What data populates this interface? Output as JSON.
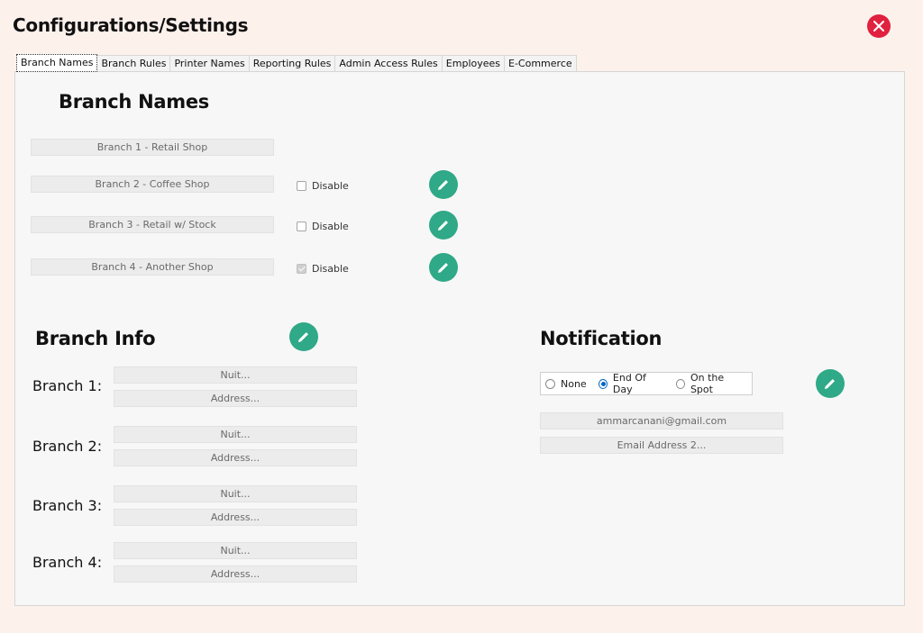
{
  "window": {
    "title": "Configurations/Settings"
  },
  "tabs": [
    {
      "label": "Branch Names"
    },
    {
      "label": "Branch Rules"
    },
    {
      "label": "Printer Names"
    },
    {
      "label": "Reporting Rules"
    },
    {
      "label": "Admin Access Rules"
    },
    {
      "label": "Employees"
    },
    {
      "label": "E-Commerce"
    }
  ],
  "branch_names": {
    "heading": "Branch Names",
    "rows": [
      {
        "value": "Branch 1 - Retail Shop"
      },
      {
        "value": "Branch 2 - Coffee Shop",
        "disable_label": "Disable",
        "disabled": false
      },
      {
        "value": "Branch 3 - Retail w/ Stock",
        "disable_label": "Disable",
        "disabled": false
      },
      {
        "value": "Branch 4 - Another Shop",
        "disable_label": "Disable",
        "disabled": true
      }
    ]
  },
  "branch_info": {
    "heading": "Branch Info",
    "branches": [
      {
        "label": "Branch 1:",
        "nuit_placeholder": "Nuit...",
        "address_placeholder": "Address..."
      },
      {
        "label": "Branch 2:",
        "nuit_placeholder": "Nuit...",
        "address_placeholder": "Address..."
      },
      {
        "label": "Branch 3:",
        "nuit_placeholder": "Nuit...",
        "address_placeholder": "Address..."
      },
      {
        "label": "Branch 4:",
        "nuit_placeholder": "Nuit...",
        "address_placeholder": "Address..."
      }
    ]
  },
  "notification": {
    "heading": "Notification",
    "options": [
      {
        "label": "None",
        "selected": false
      },
      {
        "label": "End Of Day",
        "selected": true
      },
      {
        "label": "On the Spot",
        "selected": false
      }
    ],
    "email1": "ammarcanani@gmail.com",
    "email2_placeholder": "Email Address 2..."
  },
  "icons": {
    "close": "close-icon",
    "edit": "pencil-icon"
  },
  "colors": {
    "background": "#fdf1ec",
    "close": "#e0213f",
    "edit": "#2fa987",
    "radio_selected": "#0067c0"
  }
}
